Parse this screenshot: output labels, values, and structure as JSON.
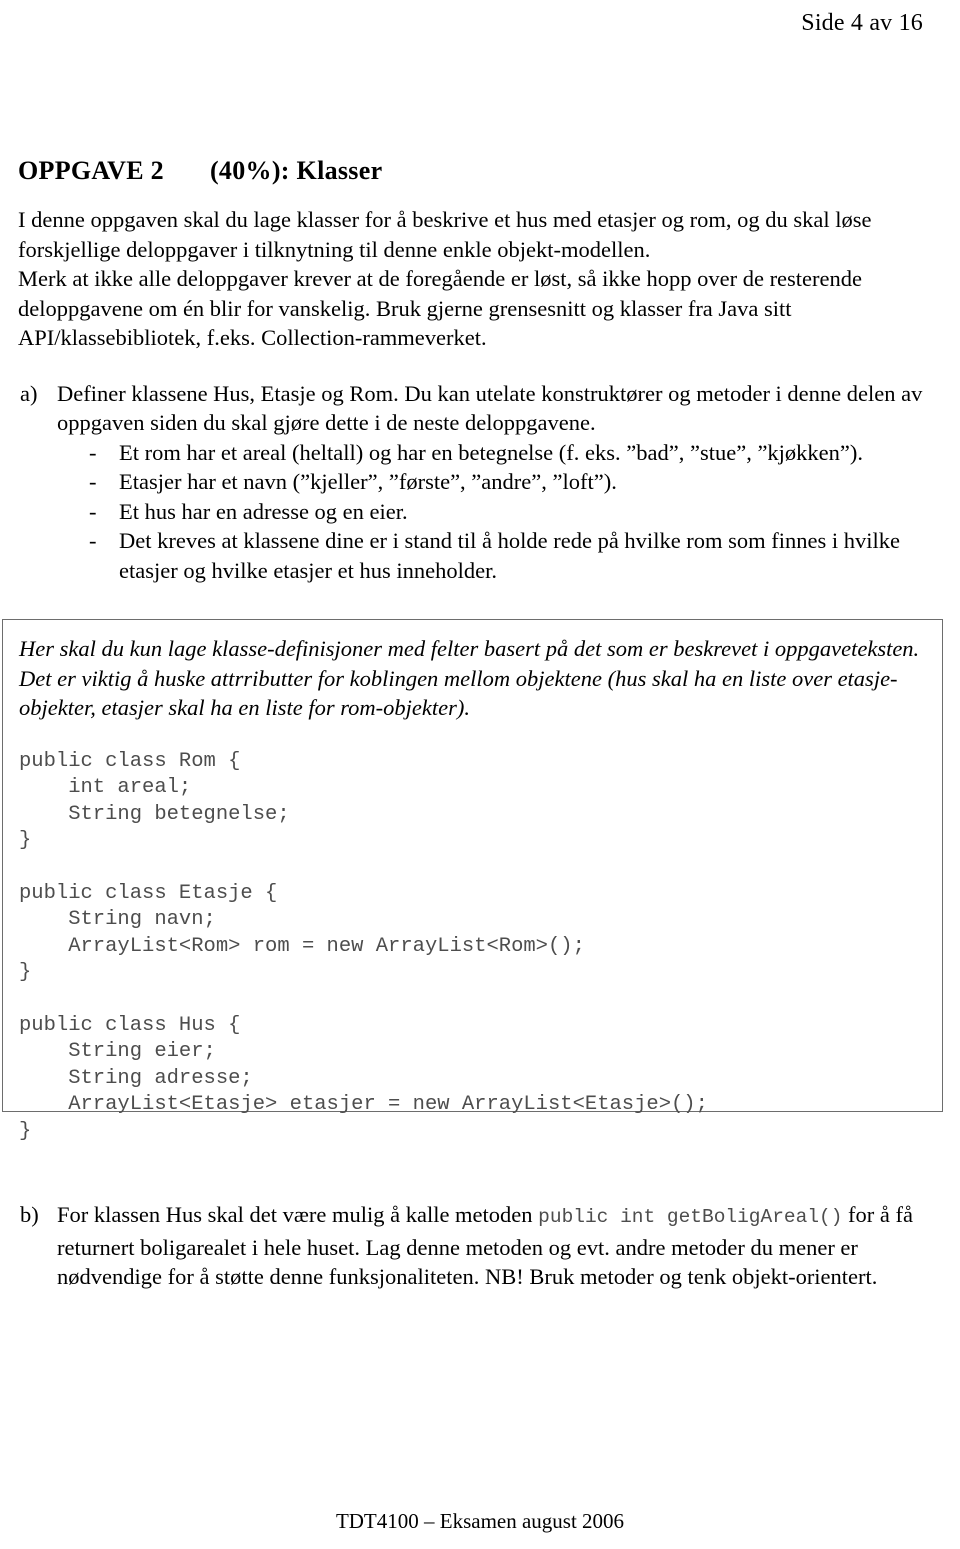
{
  "header": {
    "page_label": "Side 4 av 16"
  },
  "title": {
    "part1": "OPPGAVE 2",
    "part2": "(40%):  Klasser"
  },
  "intro": {
    "paragraph1": "I denne oppgaven skal du lage klasser for å beskrive et hus med etasjer og rom, og du skal løse forskjellige deloppgaver i tilknytning til denne enkle objekt-modellen.",
    "paragraph2": "Merk at ikke alle deloppgaver krever at de foregående er løst, så ikke hopp over de resterende deloppgavene om én blir for vanskelig. Bruk gjerne grensesnitt og klasser fra Java sitt API/klassebibliotek, f.eks. Collection-rammeverket."
  },
  "items": [
    {
      "marker": "a)",
      "text": "Definer klassene Hus, Etasje og Rom. Du kan utelate konstruktører og metoder i denne delen av oppgaven siden du skal gjøre dette i de neste deloppgavene.",
      "bullets": [
        "Et rom har et areal (heltall) og har en betegnelse (f. eks. ”bad”, ”stue”, ”kjøkken”).",
        "Etasjer har et navn (”kjeller”, ”første”, ”andre”, ”loft”).",
        "Et hus har en adresse og en eier.",
        "Det kreves at klassene dine er i stand til å holde rede på hvilke rom som finnes i hvilke etasjer og hvilke etasjer et hus inneholder."
      ]
    }
  ],
  "note_box": {
    "note": "Her skal du kun lage klasse-definisjoner med felter basert på det som er beskrevet i oppgaveteksten. Det er viktig å huske attrributter for koblingen mellom objektene (hus skal ha en liste over etasje-objekter, etasjer skal ha en liste for rom-objekter).",
    "code_blocks": [
      "public class Rom {\n    int areal;\n    String betegnelse;\n}",
      "public class Etasje {\n    String navn;\n    ArrayList<Rom> rom = new ArrayList<Rom>();\n}",
      "public class Hus {\n    String eier;\n    String adresse;\n    ArrayList<Etasje> etasjer = new ArrayList<Etasje>();\n}"
    ]
  },
  "item_b": {
    "marker": "b)",
    "text_before": "For klassen Hus skal det være mulig å kalle metoden ",
    "code": "public int getBoligAreal()",
    "text_after": " for å få returnert boligarealet i hele huset. Lag denne metoden og evt. andre metoder du mener er nødvendige for å støtte denne funksjonaliteten. NB! Bruk metoder og tenk objekt-orientert."
  },
  "footer": {
    "text": "TDT4100 – Eksamen august 2006"
  },
  "colors": {
    "text": "#000000",
    "code": "#4d4d4d",
    "box_border": "#6d6d6d",
    "background": "#ffffff"
  }
}
